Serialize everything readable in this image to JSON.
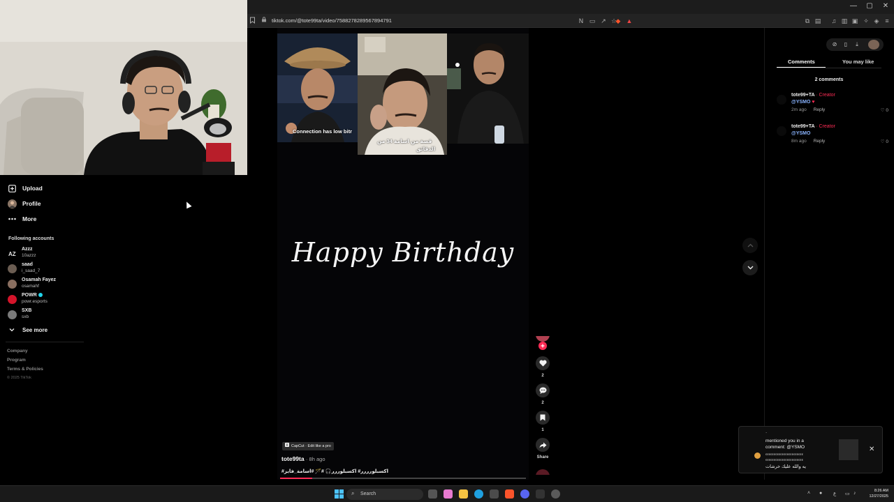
{
  "browser": {
    "url": "tiktok.com/@tote99ta/video/7588278289567894791",
    "window_controls": [
      "—",
      "▢",
      "✕"
    ]
  },
  "sidebar": {
    "items": [
      {
        "label": "Upload",
        "icon": "upload-icon"
      },
      {
        "label": "Profile",
        "icon": "avatar"
      },
      {
        "label": "More",
        "icon": "more-icon"
      }
    ],
    "following_title": "Following accounts",
    "accounts": [
      {
        "name": "Azzz",
        "handle": "10azzz",
        "color": "#e6e6e6"
      },
      {
        "name": "saad",
        "handle": "i_saad_7",
        "color": "#6b5d52"
      },
      {
        "name": "Osamah Fayez",
        "handle": "osamahf",
        "color": "#8a6f60"
      },
      {
        "name": "POWR",
        "handle": "powr.esports",
        "color": "#d4142a",
        "verified": true
      },
      {
        "name": "SXB",
        "handle": "sxb",
        "color": "#7a7a7a"
      }
    ],
    "see_more": "See more",
    "footer_links": [
      "Company",
      "Program",
      "Terms & Policies"
    ],
    "copyright": "© 2025 TikTok"
  },
  "video": {
    "collage_captions": {
      "left": "Connection has low bitr",
      "middle_1": "قصة من اسامة  34 من",
      "middle_2": "الدقائق"
    },
    "headline": "Happy Birthday",
    "capcut_label": "CapCut · Edit like a pro",
    "author": "tote99ta",
    "posted": "· 8h ago",
    "hashtags": "#اكسبلورررر# اكسبلوررر🎧 #🪄 #اسامة_فايز",
    "progress": 0.13
  },
  "actions": {
    "likes": "2",
    "comments": "2",
    "saves": "1",
    "share": "Share"
  },
  "comments_panel": {
    "tabs": [
      "Comments",
      "You may like"
    ],
    "count_label": "2 comments",
    "comments": [
      {
        "user": "tote99+TA",
        "badge": "· Creator",
        "text": "@YSMO",
        "time": "2m ago",
        "reply": "Reply",
        "likes": "0"
      },
      {
        "user": "tote99+TA",
        "badge": "· Creator",
        "text": "@YSMO",
        "time": "8m ago",
        "reply": "Reply",
        "likes": "0"
      }
    ]
  },
  "notification": {
    "line0": "·",
    "line1": "mentioned you in a",
    "line2": "comment: @YSMO",
    "line3": "ءءءءءءءءءءءءءءءءءءءءءءء",
    "line4": "ءءءءءءءءءءءءءءءءءءءءءءء",
    "line5": "يه والله عليك خرشات"
  },
  "taskbar": {
    "search_label": "Search",
    "time": "8:26 AM",
    "date": "12/27/2025",
    "lang": "ع"
  },
  "colors": {
    "accent": "#fe2c55",
    "mention": "#8ab4ff"
  }
}
